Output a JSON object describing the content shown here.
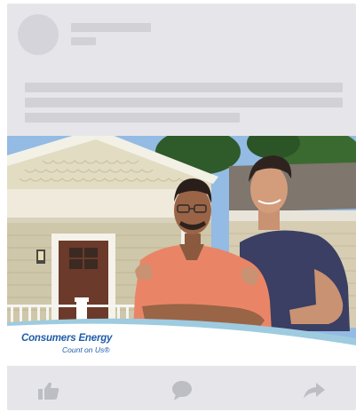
{
  "post": {
    "ad": {
      "brand_name": "Consumers Energy",
      "tagline": "Count on Us®"
    }
  },
  "actions": {
    "like_icon": "thumbs-up-icon",
    "comment_icon": "speech-bubble-icon",
    "share_icon": "share-arrow-icon"
  },
  "colors": {
    "card_bg": "#e6e6ea",
    "placeholder": "#d1d1d6",
    "brand_blue": "#1f5da8",
    "icon_gray": "#bdbdc4"
  }
}
